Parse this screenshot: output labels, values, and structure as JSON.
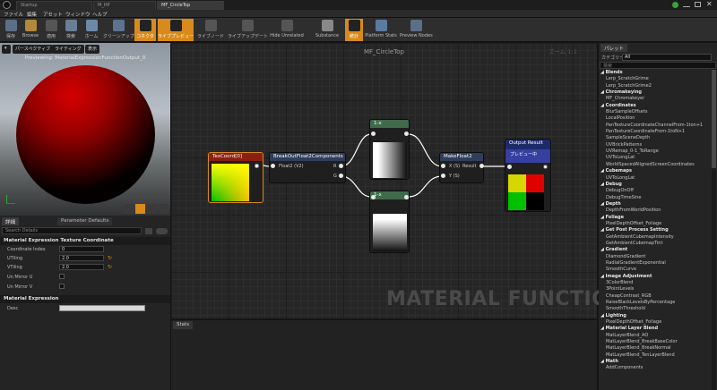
{
  "title_bar": {
    "tabs": [
      {
        "label": "Startup"
      },
      {
        "label": "M_HP"
      },
      {
        "label": "MF_CircleTop"
      }
    ]
  },
  "menu": {
    "items": [
      "ファイル",
      "編集",
      "アセット",
      "ウィンドウ",
      "ヘルプ"
    ]
  },
  "toolbar": {
    "buttons": [
      {
        "label": "保存",
        "icon": "save-icon"
      },
      {
        "label": "Browse",
        "icon": "folder-icon"
      },
      {
        "label": "適用",
        "icon": "apply-icon"
      },
      {
        "label": "検索",
        "icon": "magnify-icon"
      },
      {
        "label": "ホーム",
        "icon": "home-icon"
      },
      {
        "label": "クリーンアップ",
        "icon": "broom-icon"
      },
      {
        "label": "コネクタ",
        "icon": "connector-icon"
      },
      {
        "label": "ライブプレビュー",
        "icon": "live-preview-icon"
      },
      {
        "label": "ライブノード",
        "icon": "live-nodes-icon"
      },
      {
        "label": "ライブアップデート",
        "icon": "live-update-icon"
      },
      {
        "label": "Hide Unrelated",
        "icon": "hide-unrelated-icon"
      },
      {
        "label": "Substance",
        "icon": "substance-icon"
      },
      {
        "label": "統計",
        "icon": "stats-icon"
      },
      {
        "label": "Platform Stats",
        "icon": "platform-stats-icon"
      },
      {
        "label": "Preview Nodes",
        "icon": "preview-nodes-icon"
      }
    ]
  },
  "viewport": {
    "perspective_label": "パースペクティブ",
    "lighting_label": "ライティング",
    "show_label": "表示",
    "caption": "Previewing: MaterialExpressionFunctionOutput_0"
  },
  "details": {
    "tab_details": "詳細",
    "tab_param_defaults": "Parameter Defaults",
    "search_placeholder": "Search Details",
    "section_texcoord": "Material Expression Texture Coordinate",
    "props": [
      {
        "label": "Coordinate Index",
        "value": "0"
      },
      {
        "label": "UTiling",
        "value": "2.0"
      },
      {
        "label": "VTiling",
        "value": "2.0"
      },
      {
        "label": "Un Mirror U",
        "value": ""
      },
      {
        "label": "Un Mirror V",
        "value": ""
      }
    ],
    "section_expression": "Material Expression",
    "desc_label": "Desc"
  },
  "graph": {
    "title": "MF_CircleTop",
    "zoom": "ズーム 1:1",
    "watermark": "MATERIAL FUNCTION",
    "nodes": {
      "texcoord": {
        "title": "TexCoord[0]"
      },
      "breakout": {
        "title": "BreakOutFloat2Components",
        "input": "Float2 (V2)",
        "out_r": "R",
        "out_g": "G"
      },
      "one_minus_top": {
        "title": "1-x"
      },
      "one_minus_bottom": {
        "title": "1-x"
      },
      "makefloat": {
        "title": "MakeFloat2",
        "in_x": "X (S)",
        "in_y": "Y (S)",
        "out": "Result"
      },
      "output": {
        "title": "Output Result",
        "sub": "プレビュー中"
      }
    }
  },
  "stats": {
    "tab": "Stats"
  },
  "palette": {
    "tab": "パレット",
    "category_label": "カテゴリー",
    "category_value": "All",
    "search_placeholder": "検索",
    "list": [
      {
        "type": "cat",
        "label": "Blends"
      },
      {
        "type": "item",
        "label": "Lerp_ScratchGrime"
      },
      {
        "type": "item",
        "label": "Lerp_ScratchGrime2"
      },
      {
        "type": "cat",
        "label": "Chromakeying"
      },
      {
        "type": "item",
        "label": "MF_Chromakeyer"
      },
      {
        "type": "cat",
        "label": "Coordinates"
      },
      {
        "type": "item",
        "label": "BlurSampleOffsets"
      },
      {
        "type": "item",
        "label": "LocalPosition"
      },
      {
        "type": "item",
        "label": "PanTextureCoordinateChannelFrom-1ton+1"
      },
      {
        "type": "item",
        "label": "PanTextureCoordinateFrom-1toN+1"
      },
      {
        "type": "item",
        "label": "SampleSceneDepth"
      },
      {
        "type": "item",
        "label": "UVBrickPatterns"
      },
      {
        "type": "item",
        "label": "UVRemap_0-1_ToRange"
      },
      {
        "type": "item",
        "label": "UVToLongLat"
      },
      {
        "type": "item",
        "label": "WorldSpacedAlignedScreenCoordinates"
      },
      {
        "type": "cat",
        "label": "Cubemaps"
      },
      {
        "type": "item",
        "label": "UVToLongLat"
      },
      {
        "type": "cat",
        "label": "Debug"
      },
      {
        "type": "item",
        "label": "DebugOnOff"
      },
      {
        "type": "item",
        "label": "DebugTimeSine"
      },
      {
        "type": "cat",
        "label": "Depth"
      },
      {
        "type": "item",
        "label": "DepthFromWorldPosition"
      },
      {
        "type": "cat",
        "label": "Foliage"
      },
      {
        "type": "item",
        "label": "PixelDepthOffset_Foliage"
      },
      {
        "type": "cat",
        "label": "Get Post Process Setting"
      },
      {
        "type": "item",
        "label": "GetAmbientCubemapIntensity"
      },
      {
        "type": "item",
        "label": "GetAmbientCubemapTint"
      },
      {
        "type": "cat",
        "label": "Gradient"
      },
      {
        "type": "item",
        "label": "DiamondGradient"
      },
      {
        "type": "item",
        "label": "RadialGradientExponential"
      },
      {
        "type": "item",
        "label": "SmoothCurve"
      },
      {
        "type": "cat",
        "label": "Image Adjustment"
      },
      {
        "type": "item",
        "label": "3ColorBlend"
      },
      {
        "type": "item",
        "label": "3PointLevels"
      },
      {
        "type": "item",
        "label": "CheapContrast_RGB"
      },
      {
        "type": "item",
        "label": "RaiseBlackLevelsByPercentage"
      },
      {
        "type": "item",
        "label": "SmoothThreshold"
      },
      {
        "type": "cat",
        "label": "Lighting"
      },
      {
        "type": "item",
        "label": "PixelDepthOffset_Foliage"
      },
      {
        "type": "cat",
        "label": "Material Layer Blend"
      },
      {
        "type": "item",
        "label": "MatLayerBlend_AO"
      },
      {
        "type": "item",
        "label": "MatLayerBlend_BreakBaseColor"
      },
      {
        "type": "item",
        "label": "MatLayerBlend_BreakNormal"
      },
      {
        "type": "item",
        "label": "MatLayerBlend_TenLayerBlend"
      },
      {
        "type": "cat",
        "label": "Math"
      },
      {
        "type": "item",
        "label": "AddComponents"
      }
    ]
  }
}
